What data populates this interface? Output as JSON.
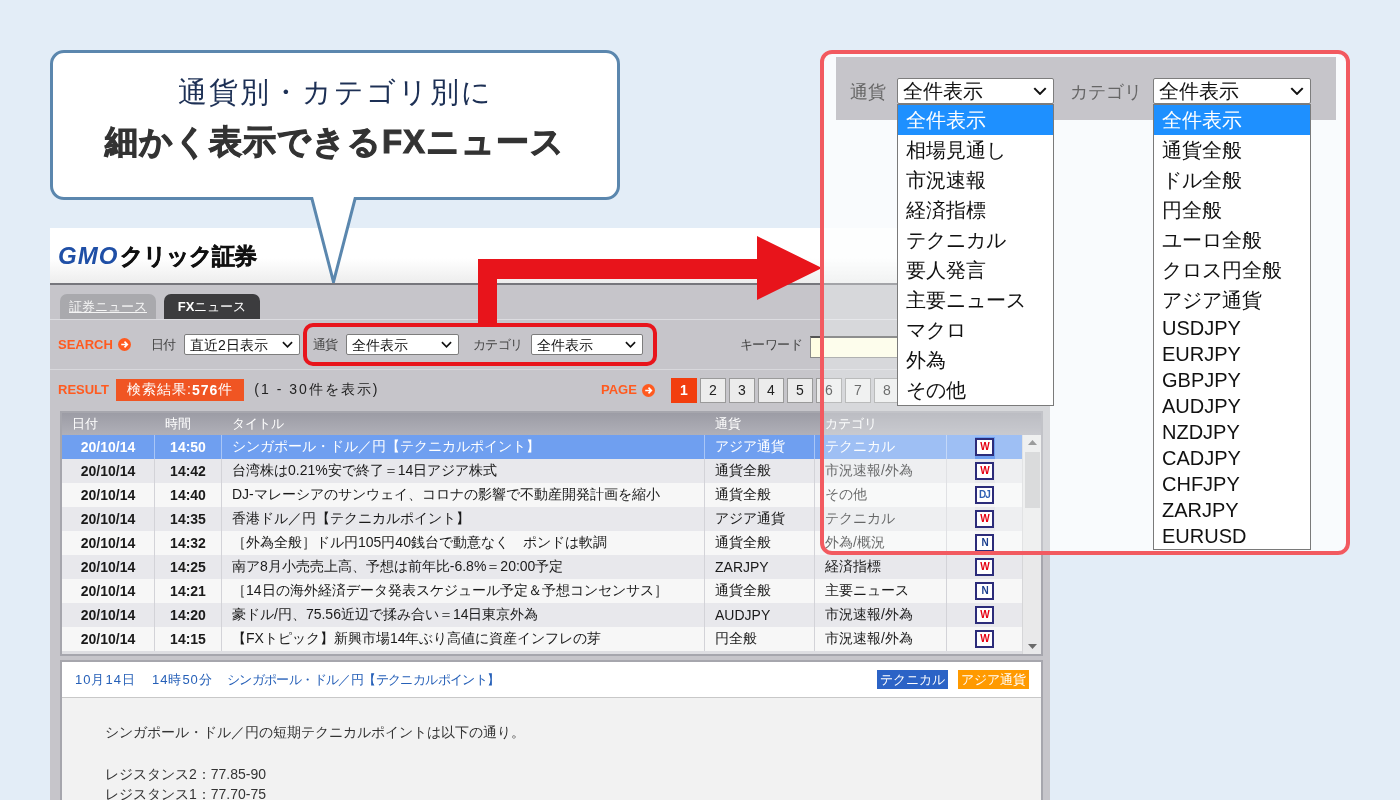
{
  "callout": {
    "subtitle": "通貨別・カテゴリ別に",
    "title": "細かく表示できるFXニュース"
  },
  "logo": {
    "brand": "GMO",
    "name": "クリック証券"
  },
  "tabs": [
    {
      "label": "証券ニュース",
      "selected": false
    },
    {
      "label": "**FX**ニュース",
      "selected": true
    }
  ],
  "search": {
    "label": "SEARCH",
    "date_filter": {
      "label": "日付",
      "value": "直近2日表示"
    },
    "highlighted_filters": [
      {
        "label": "通貨",
        "value": "全件表示"
      },
      {
        "label": "カテゴリ",
        "value": "全件表示"
      }
    ],
    "keyword": {
      "label": "キーワード"
    }
  },
  "result": {
    "label": "RESULT",
    "count": "検索結果:**576**件",
    "range": "(1 - 30件を表示)"
  },
  "pagination": {
    "label": "PAGE",
    "pages": [
      {
        "label": "1",
        "selected": true
      },
      {
        "label": "2",
        "selected": false
      },
      {
        "label": "3",
        "selected": false
      },
      {
        "label": "4",
        "selected": false
      },
      {
        "label": "5",
        "selected": false
      },
      {
        "label": "6",
        "selected": false
      },
      {
        "label": "7",
        "selected": false
      },
      {
        "label": "8",
        "selected": false
      }
    ]
  },
  "table": {
    "columns": [
      "日付",
      "時間",
      "タイトル",
      "通貨",
      "カテゴリ"
    ],
    "rows": [
      {
        "date": "20/10/14",
        "time": "14:50",
        "title": "シンガポール・ドル／円【テクニカルポイント】",
        "currency": "アジア通貨",
        "category": "テクニカル",
        "source": {
          "label": "W",
          "color": "#e60012"
        },
        "selected": true
      },
      {
        "date": "20/10/14",
        "time": "14:42",
        "title": "台湾株は0.21%安で終了＝14日アジア株式",
        "currency": "通貨全般",
        "category": "市況速報/外為",
        "source": {
          "label": "W",
          "color": "#e60012"
        },
        "selected": false
      },
      {
        "date": "20/10/14",
        "time": "14:40",
        "title": "DJ-マレーシアのサンウェイ、コロナの影響で不動産開発計画を縮小",
        "currency": "通貨全般",
        "category": "その他",
        "source": {
          "label": "DJ",
          "color": "#2f5fb3"
        },
        "selected": false
      },
      {
        "date": "20/10/14",
        "time": "14:35",
        "title": "香港ドル／円【テクニカルポイント】",
        "currency": "アジア通貨",
        "category": "テクニカル",
        "source": {
          "label": "W",
          "color": "#e60012"
        },
        "selected": false
      },
      {
        "date": "20/10/14",
        "time": "14:32",
        "title": "［外為全般］ドル円105円40銭台で動意なく　ポンドは軟調",
        "currency": "通貨全般",
        "category": "外為/概況",
        "source": {
          "label": "N",
          "color": "#1b3f8f"
        },
        "selected": false
      },
      {
        "date": "20/10/14",
        "time": "14:25",
        "title": "南ア8月小売売上高、予想は前年比-6.8%＝20:00予定",
        "currency": "ZARJPY",
        "category": "経済指標",
        "source": {
          "label": "W",
          "color": "#e60012"
        },
        "selected": false
      },
      {
        "date": "20/10/14",
        "time": "14:21",
        "title": "［14日の海外経済データ発表スケジュール予定＆予想コンセンサス］",
        "currency": "通貨全般",
        "category": "主要ニュース",
        "source": {
          "label": "N",
          "color": "#1b3f8f"
        },
        "selected": false
      },
      {
        "date": "20/10/14",
        "time": "14:20",
        "title": "豪ドル/円、75.56近辺で揉み合い＝14日東京外為",
        "currency": "AUDJPY",
        "category": "市況速報/外為",
        "source": {
          "label": "W",
          "color": "#e60012"
        },
        "selected": false
      },
      {
        "date": "20/10/14",
        "time": "14:15",
        "title": "【FXトピック】新興市場14年ぶり高値に資産インフレの芽",
        "currency": "円全般",
        "category": "市況速報/外為",
        "source": {
          "label": "W",
          "color": "#e60012"
        },
        "selected": false
      }
    ]
  },
  "article": {
    "date": "10月14日",
    "time": "14時50分",
    "title": "シンガポール・ドル／円【テクニカルポイント】",
    "tags": [
      {
        "label": "テクニカル",
        "color": "#2b63c6"
      },
      {
        "label": "アジア通貨",
        "color": "#ff9a00"
      }
    ],
    "body": [
      "シンガポール・ドル／円の短期テクニカルポイントは以下の通り。",
      "レジスタンス2：77.85-90",
      "レジスタンス1：77.70-75"
    ]
  },
  "zoom_panel": {
    "filters": [
      {
        "label": "通貨",
        "value": "全件表示",
        "options": [
          {
            "label": "全件表示",
            "selected": true
          },
          {
            "label": "相場見通し",
            "selected": false
          },
          {
            "label": "市況速報",
            "selected": false
          },
          {
            "label": "経済指標",
            "selected": false
          },
          {
            "label": "テクニカル",
            "selected": false
          },
          {
            "label": "要人発言",
            "selected": false
          },
          {
            "label": "主要ニュース",
            "selected": false
          },
          {
            "label": "マクロ",
            "selected": false
          },
          {
            "label": "外為",
            "selected": false
          },
          {
            "label": "その他",
            "selected": false
          }
        ]
      },
      {
        "label": "カテゴリ",
        "value": "全件表示",
        "options": [
          {
            "label": "全件表示",
            "selected": true
          },
          {
            "label": "通貨全般",
            "selected": false
          },
          {
            "label": "ドル全般",
            "selected": false
          },
          {
            "label": "円全般",
            "selected": false
          },
          {
            "label": "ユーロ全般",
            "selected": false
          },
          {
            "label": "クロス円全般",
            "selected": false
          },
          {
            "label": "アジア通貨",
            "selected": false
          },
          {
            "label": "USDJPY",
            "selected": false
          },
          {
            "label": "EURJPY",
            "selected": false
          },
          {
            "label": "GBPJPY",
            "selected": false
          },
          {
            "label": "AUDJPY",
            "selected": false
          },
          {
            "label": "NZDJPY",
            "selected": false
          },
          {
            "label": "CADJPY",
            "selected": false
          },
          {
            "label": "CHFJPY",
            "selected": false
          },
          {
            "label": "ZARJPY",
            "selected": false
          },
          {
            "label": "EURUSD",
            "selected": false
          }
        ]
      }
    ]
  }
}
